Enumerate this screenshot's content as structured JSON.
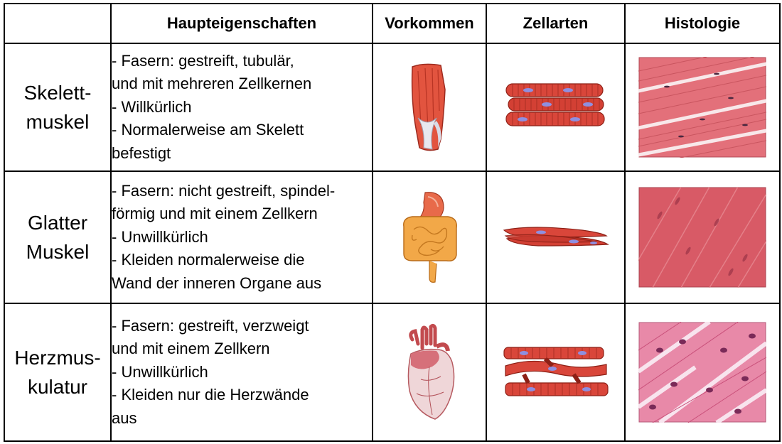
{
  "headers": [
    "",
    "Haupteigenschaften",
    "Vorkommen",
    "Zellarten",
    "Histologie"
  ],
  "rows": [
    {
      "label": [
        "Skelett-",
        "muskel"
      ],
      "properties": [
        "- Fasern: gestreift, tubulär,",
        "und mit mehreren Zellkernen",
        "- Willkürlich",
        "- Normalerweise am Skelett",
        "befestigt"
      ],
      "vorkommen_icon": "arm-muscle-icon",
      "zellart_icon": "skeletal-muscle-cells-icon",
      "histologie_icon": "skeletal-muscle-histology-icon"
    },
    {
      "label": [
        "Glatter",
        "Muskel"
      ],
      "properties": [
        "- Fasern: nicht gestreift, spindel-",
        "förmig und mit einem Zellkern",
        "- Unwillkürlich",
        "- Kleiden normalerweise die",
        "Wand der inneren Organe aus"
      ],
      "vorkommen_icon": "digestive-organs-icon",
      "zellart_icon": "smooth-muscle-cells-icon",
      "histologie_icon": "smooth-muscle-histology-icon"
    },
    {
      "label": [
        "Herzmus-",
        "kulatur"
      ],
      "properties": [
        "- Fasern: gestreift, verzweigt",
        "und mit einem Zellkern",
        "- Unwillkürlich",
        "- Kleiden nur die Herzwände",
        "aus"
      ],
      "vorkommen_icon": "heart-icon",
      "zellart_icon": "cardiac-muscle-cells-icon",
      "histologie_icon": "cardiac-muscle-histology-icon"
    }
  ],
  "colors": {
    "muscle": "#d9463a",
    "muscle_dark": "#a8281f",
    "nucleus": "#8f8fe0",
    "tissue": "#e1727b",
    "intestine": "#f0a040",
    "border": "#000000"
  }
}
